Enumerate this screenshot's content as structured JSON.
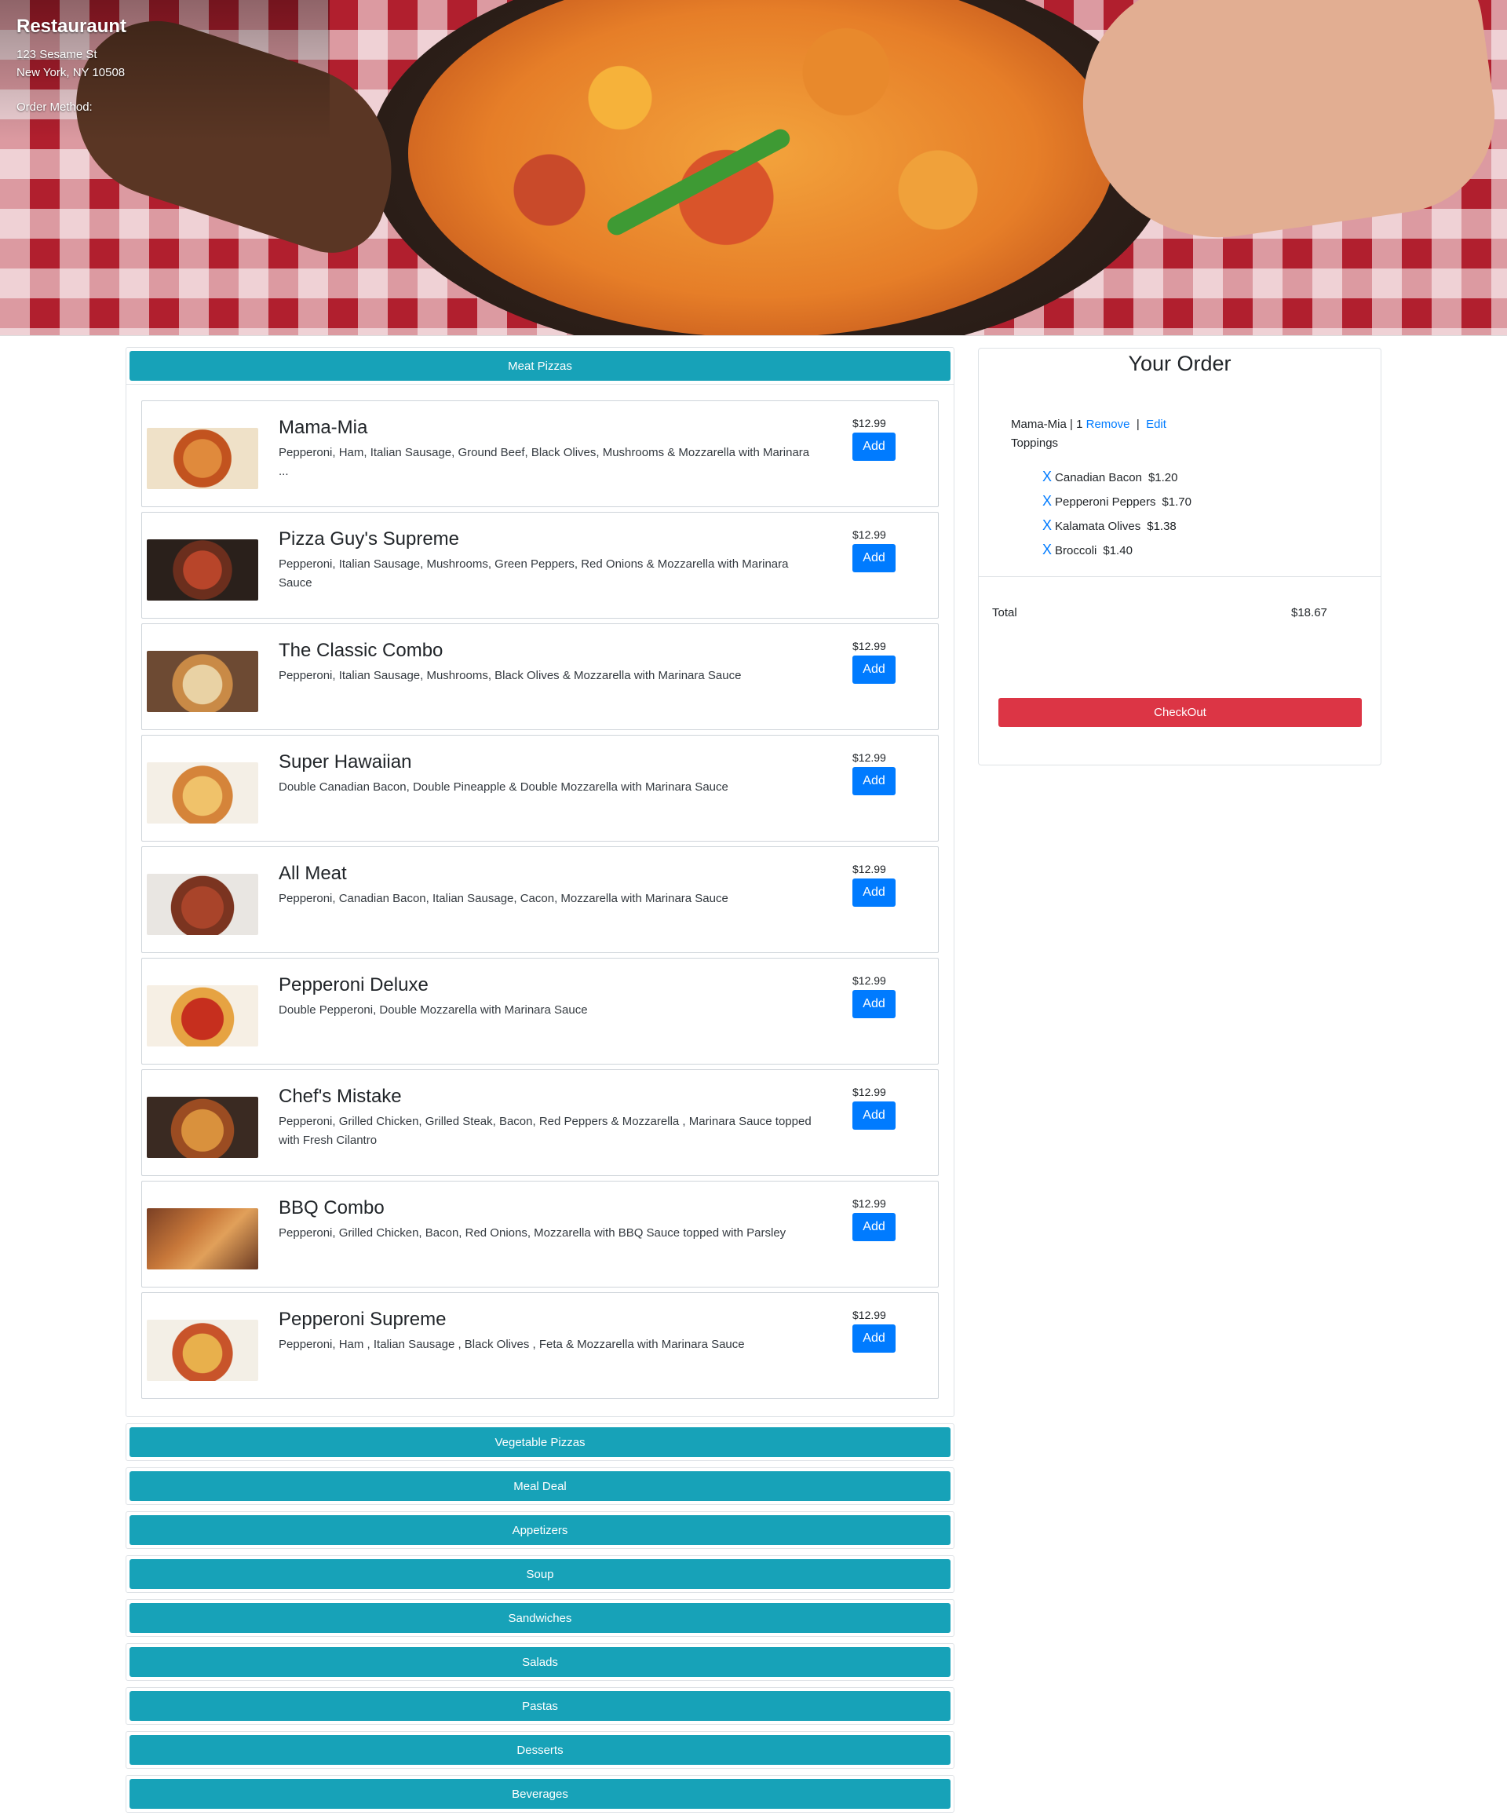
{
  "header": {
    "title": "Restauraunt",
    "address_line1": "123 Sesame St",
    "address_line2": "New York, NY 10508",
    "order_method_label": "Order Method:"
  },
  "menu": {
    "open_category": "Meat Pizzas",
    "items": [
      {
        "name": "Mama-Mia",
        "desc": "Pepperoni, Ham, Italian Sausage, Ground Beef, Black Olives, Mushrooms & Mozzarella with Marinara ...",
        "price": "$12.99",
        "add_label": "Add"
      },
      {
        "name": "Pizza Guy's Supreme",
        "desc": "Pepperoni, Italian Sausage, Mushrooms, Green Peppers, Red Onions & Mozzarella with Marinara Sauce",
        "price": "$12.99",
        "add_label": "Add"
      },
      {
        "name": "The Classic Combo",
        "desc": "Pepperoni, Italian Sausage, Mushrooms, Black Olives & Mozzarella with Marinara Sauce",
        "price": "$12.99",
        "add_label": "Add"
      },
      {
        "name": "Super Hawaiian",
        "desc": "Double Canadian Bacon, Double Pineapple & Double Mozzarella with Marinara Sauce",
        "price": "$12.99",
        "add_label": "Add"
      },
      {
        "name": "All Meat",
        "desc": "Pepperoni, Canadian Bacon, Italian Sausage, Cacon, Mozzarella with Marinara Sauce",
        "price": "$12.99",
        "add_label": "Add"
      },
      {
        "name": "Pepperoni Deluxe",
        "desc": "Double Pepperoni, Double Mozzarella with Marinara Sauce",
        "price": "$12.99",
        "add_label": "Add"
      },
      {
        "name": "Chef's Mistake",
        "desc": "Pepperoni, Grilled Chicken, Grilled Steak, Bacon, Red Peppers & Mozzarella , Marinara Sauce topped with Fresh Cilantro",
        "price": "$12.99",
        "add_label": "Add"
      },
      {
        "name": "BBQ Combo",
        "desc": "Pepperoni, Grilled Chicken, Bacon, Red Onions, Mozzarella with BBQ Sauce topped with Parsley",
        "price": "$12.99",
        "add_label": "Add"
      },
      {
        "name": "Pepperoni Supreme",
        "desc": "Pepperoni, Ham , Italian Sausage , Black Olives , Feta & Mozzarella with Marinara Sauce",
        "price": "$12.99",
        "add_label": "Add"
      }
    ],
    "other_categories": [
      "Vegetable Pizzas",
      "Meal Deal",
      "Appetizers",
      "Soup",
      "Sandwiches",
      "Salads",
      "Pastas",
      "Desserts",
      "Beverages"
    ]
  },
  "order": {
    "title": "Your Order",
    "item_name": "Mama-Mia",
    "separator": "|",
    "quantity": "1",
    "remove_label": "Remove",
    "edit_label": "Edit",
    "toppings_label": "Toppings",
    "toppings": [
      {
        "x": "X",
        "name": "Canadian Bacon",
        "price": "$1.20"
      },
      {
        "x": "X",
        "name": "Pepperoni Peppers",
        "price": "$1.70"
      },
      {
        "x": "X",
        "name": "Kalamata Olives",
        "price": "$1.38"
      },
      {
        "x": "X",
        "name": "Broccoli",
        "price": "$1.40"
      }
    ],
    "total_label": "Total",
    "total_value": "$18.67",
    "checkout_label": "CheckOut"
  },
  "colors": {
    "category_button": "#17a2b8",
    "add_button": "#007bff",
    "checkout_button": "#dc3545",
    "link": "#007bff"
  }
}
